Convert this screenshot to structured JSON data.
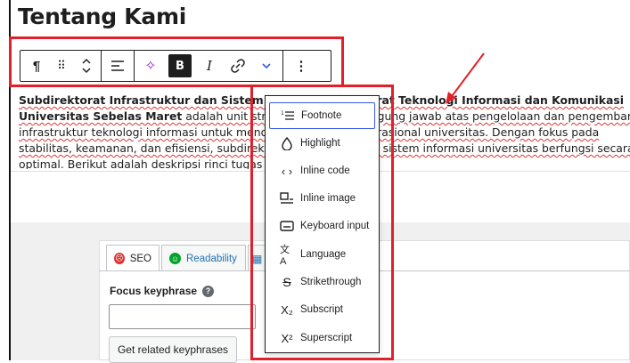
{
  "heading": "Tentang Kami",
  "toolbar": {
    "paragraph_icon": "¶",
    "drag_icon": "⠿",
    "move_icon": "⌃⌄",
    "align_icon": "☰",
    "ai_icon": "✧",
    "bold_label": "B",
    "italic_label": "I",
    "link_icon": "🔗",
    "more_icon": "⌄",
    "options_icon": "⋮"
  },
  "paragraph": {
    "line1": "Subdirektorat Infrastruktur dan Sistem Informasi Direktorat Teknologi Informasi dan Komunikasi",
    "line2a": "Universitas Sebelas Maret",
    "line2b": " adalah unit strategis yang bertanggung jawab atas pengelolaan dan pengembangan",
    "line3": "infrastruktur teknologi informasi untuk mendukung kegiatan operasional universitas. Dengan fokus pada",
    "line4": "stabilitas, keamanan, dan efisiensi, subdirektorat ini memastikan sistem informasi universitas berfungsi secara",
    "line5": "optimal. Berikut adalah deskripsi rinci tugas utama:"
  },
  "dropdown": {
    "items": [
      {
        "label": "Footnote",
        "icon": "⋮≡"
      },
      {
        "label": "Highlight",
        "icon": "◯"
      },
      {
        "label": "Inline code",
        "icon": "‹ ›"
      },
      {
        "label": "Inline image",
        "icon": "▭"
      },
      {
        "label": "Keyboard input",
        "icon": "⌨"
      },
      {
        "label": "Language",
        "icon": "文A"
      },
      {
        "label": "Strikethrough",
        "icon": "S"
      },
      {
        "label": "Subscript",
        "icon": "X₂"
      },
      {
        "label": "Superscript",
        "icon": "X²"
      }
    ]
  },
  "seo": {
    "tab_seo": "SEO",
    "tab_readability": "Readability",
    "focus_label": "Focus keyphrase",
    "help_glyph": "?",
    "focus_value": "",
    "related_button": "Get related keyphrases"
  },
  "colors": {
    "highlight_red": "#e0202a",
    "focus_blue": "#3858e9",
    "seo_bad": "#dc3232",
    "readability_good": "#00a32a"
  }
}
